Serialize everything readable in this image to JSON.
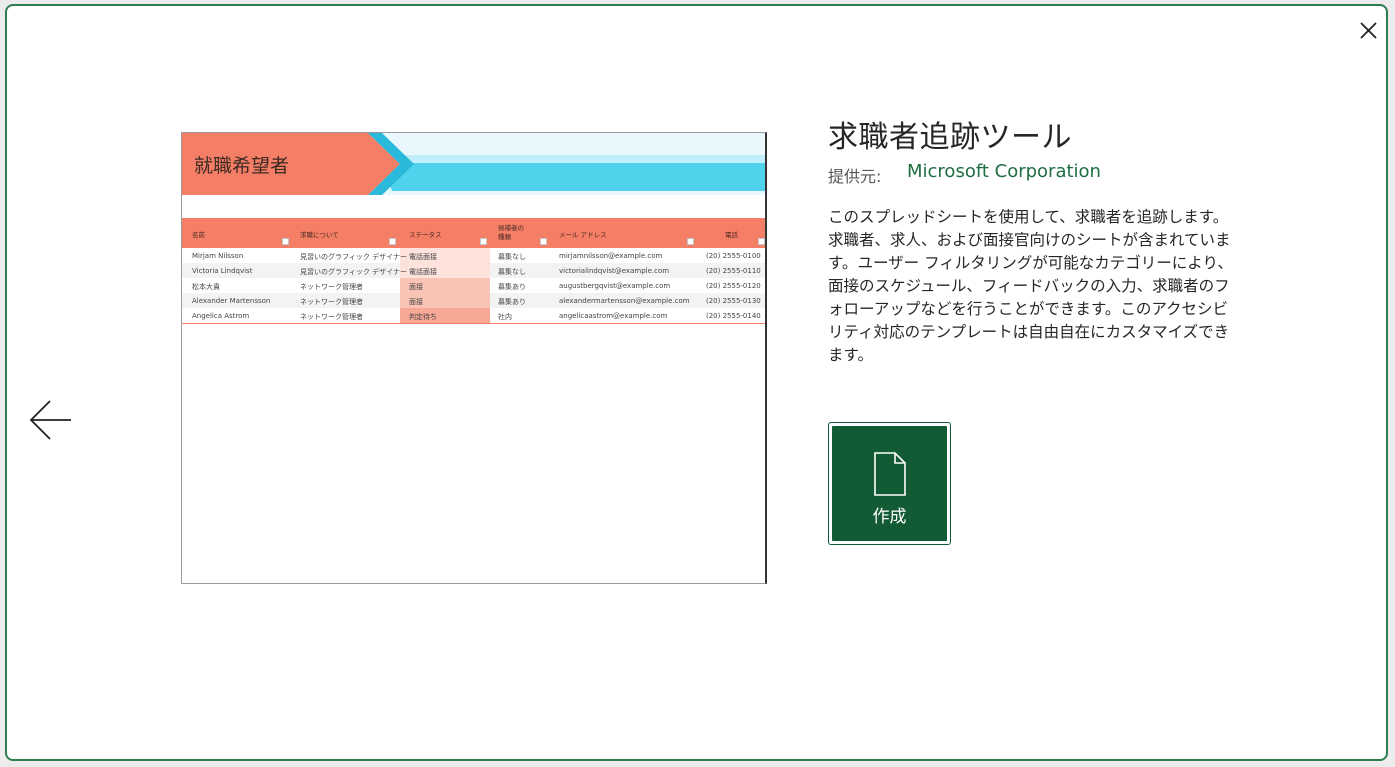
{
  "dialog": {
    "close_icon": "close-icon",
    "back_icon": "arrow-left-icon"
  },
  "template": {
    "title": "求職者追跡ツール",
    "provider_label": "提供元:",
    "provider_name": "Microsoft Corporation",
    "description": "このスプレッドシートを使用して、求職者を追跡します。求職者、求人、および面接官向けのシートが含まれています。ユーザー フィルタリングが可能なカテゴリーにより、面接のスケジュール、フィードバックの入力、求職者のフォローアップなどを行うことができます。このアクセシビリティ対応のテンプレートは自由自在にカスタマイズできます。",
    "create_label": "作成",
    "create_icon": "document-icon"
  },
  "preview": {
    "sheet_title": "就職希望者",
    "headers": [
      "名前",
      "求職について",
      "ステータス",
      "候補者の種類",
      "メール アドレス",
      "電話"
    ],
    "rows": [
      [
        "Mirjam Nilsson",
        "見習いのグラフィック デザイナー",
        "電話面接",
        "募集なし",
        "mirjamnilsson@example.com",
        "(20) 2555-0100"
      ],
      [
        "Victoria Lindqvist",
        "見習いのグラフィック デザイナー",
        "電話面接",
        "募集なし",
        "victorialindqvist@example.com",
        "(20) 2555-0110"
      ],
      [
        "松本大貴",
        "ネットワーク管理者",
        "面接",
        "募集あり",
        "augustbergqvist@example.com",
        "(20) 2555-0120"
      ],
      [
        "Alexander Martensson",
        "ネットワーク管理者",
        "面接",
        "募集あり",
        "alexandermartensson@example.com",
        "(20) 2555-0130"
      ],
      [
        "Angelica Astrom",
        "ネットワーク管理者",
        "判定待ち",
        "社内",
        "angelicaastrom@example.com",
        "(20) 2555-0140"
      ]
    ],
    "colors": {
      "banner_salmon": "#f47e66",
      "banner_cyan": "#4fd3ec",
      "status_light": "#fde3dc",
      "status_mid": "#f9c3b6"
    }
  },
  "theme": {
    "accent": "#135b35",
    "border": "#2e7d4f",
    "link": "#1e6e42"
  }
}
